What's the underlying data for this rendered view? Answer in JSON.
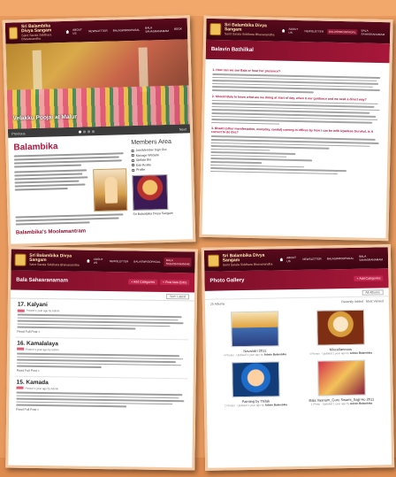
{
  "site": {
    "name": "Sri Balambika Divya Sangam",
    "tagline": "Saint Sarala Siddhara Bhavanandha"
  },
  "nav": [
    "ABOUT US",
    "NEWSLETTER",
    "BALASWROOPAGAL",
    "BALA SAHASRANAMAM",
    "BOOK"
  ],
  "card1": {
    "hero_caption": "Velakku Poojai at Malur",
    "slider_prev": "Previous",
    "slider_next": "Next",
    "title": "Balambika",
    "subtitle": "Balambika's Moolamantram",
    "side_title": "Members Area",
    "side_checks": [
      "Join/Member Sign Out",
      "Manage Website",
      "Update Bio",
      "Edit Profile",
      "Profile"
    ],
    "side_image_caption": "Sri Balambika Divya Sangam"
  },
  "card2": {
    "banner": "Balavin Bathilkal",
    "questions": [
      "1. How can we see Bala or hear her presence?",
      "2. Should Bala to know what are we doing at start of day, when it our guidance and we seek a direct way?",
      "3. Bhakti (other manifestation, everyday, sandal) coming in offices by how I can be with Upadesa Gurukul, is it correct to do this?"
    ]
  },
  "card3": {
    "banner": "Bala Sahasranamam",
    "add_button": "+ Add Categories",
    "post_button": "+ Post New Entry",
    "sort_label": "Sort: Latest",
    "entries": [
      {
        "title": "17. Kalyani",
        "meta": "Posted 1 year ago by Admin",
        "more": "Read Full Post »"
      },
      {
        "title": "16. Kamalalaya",
        "meta": "Posted 1 year ago by Admin",
        "more": "Read Full Post »"
      },
      {
        "title": "15. Kamada",
        "meta": "Posted 1 year ago by Admin",
        "more": "Read Full Post »"
      }
    ]
  },
  "card4": {
    "banner": "Photo Gallery",
    "add_button": "+ Add Categories",
    "albums_label": "25 Albums",
    "select_label": "All Albums",
    "recent_label": "Recently Added · Most Viewed",
    "items": [
      {
        "caption": "Navaratri 2011",
        "by": "4 Photos · Updated 1 year ago by",
        "user": "Admin Balambika"
      },
      {
        "caption": "Miscellaneous",
        "by": "4 Photos · Updated 1 year ago by",
        "user": "Admin Balambika"
      },
      {
        "caption": "Painting by Thilak",
        "by": "2 Photos · Updated 1 year ago by",
        "user": "Admin Balambika"
      },
      {
        "caption": "Bala Vaanam_Guru Swami_Sajji Ho 2011",
        "by": "1 Photo · Updated 1 year ago by",
        "user": "Admin Balambika"
      }
    ]
  }
}
